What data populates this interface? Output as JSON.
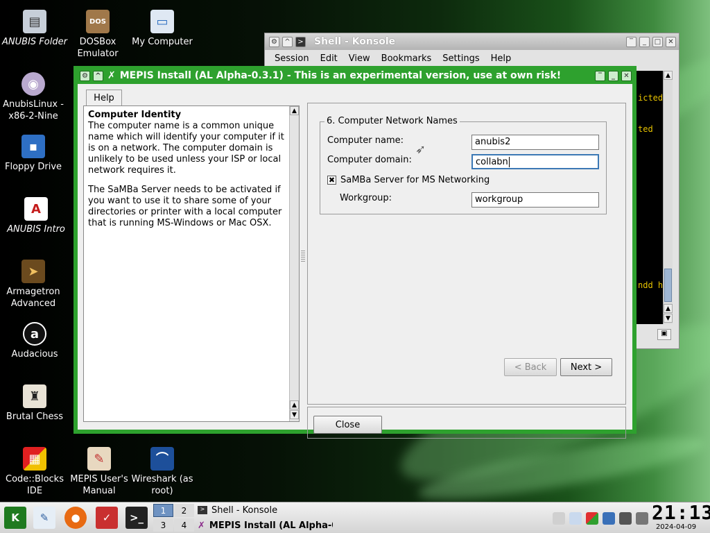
{
  "desktop_icons": [
    {
      "label": "ANUBIS Folder",
      "icon": "folder-icon",
      "italic": true
    },
    {
      "label": "DOSBox Emulator",
      "icon": "dosbox-icon",
      "italic": false
    },
    {
      "label": "My Computer",
      "icon": "computer-icon",
      "italic": false
    },
    {
      "label": "AnubisLinux -x86-2-Nine",
      "icon": "cdrom-icon",
      "italic": false
    },
    {
      "label": "Floppy Drive",
      "icon": "floppy-icon",
      "italic": false
    },
    {
      "label": "ANUBIS Intro",
      "icon": "pdf-icon",
      "italic": true
    },
    {
      "label": "Armagetron Advanced",
      "icon": "armagetron-icon",
      "italic": false
    },
    {
      "label": "Audacious",
      "icon": "audacious-icon",
      "italic": false
    },
    {
      "label": "Brutal Chess",
      "icon": "chess-icon",
      "italic": false
    },
    {
      "label": "Code::Blocks IDE",
      "icon": "codeblocks-icon",
      "italic": false
    },
    {
      "label": "MEPIS User's Manual",
      "icon": "manual-icon",
      "italic": false
    },
    {
      "label": "Wireshark (as root)",
      "icon": "wireshark-icon",
      "italic": false
    }
  ],
  "konsole": {
    "title": "Shell - Konsole",
    "menu": [
      "Session",
      "Edit",
      "View",
      "Bookmarks",
      "Settings",
      "Help"
    ],
    "terminal_lines": [
      "icted",
      "ted",
      "ndd h"
    ]
  },
  "installer": {
    "title": "MEPIS Install (AL Alpha-0.3.1) - This is an experimental version, use at own risk!",
    "help_tab": "Help",
    "help_heading": "Computer Identity",
    "help_para1": "The computer name is a common unique name which will identify your computer if it is on a network. The computer domain is unlikely to be used unless your ISP or local network requires it.",
    "help_para2": "The SaMBa Server needs to be activated if you want to use it to share some of your directories or printer with a local computer that is running MS-Windows or Mac OSX.",
    "group_title": "6. Computer Network Names",
    "computer_name_label": "Computer name:",
    "computer_name_value": "anubis2",
    "computer_domain_label": "Computer domain:",
    "computer_domain_value": "collabn",
    "samba_label": "SaMBa Server for MS Networking",
    "samba_checked": true,
    "samba_mark": "✖",
    "workgroup_label": "Workgroup:",
    "workgroup_value": "workgroup",
    "back_label": "< Back",
    "next_label": "Next >",
    "close_label": "Close"
  },
  "taskbar": {
    "launchers": [
      "kmenu-icon",
      "editor-icon",
      "firefox-icon",
      "manual-icon",
      "terminal-icon"
    ],
    "desktops": [
      "1",
      "2",
      "3",
      "4"
    ],
    "active_desktop": "1",
    "tasks": [
      "Shell - Konsole",
      "MEPIS Install (AL Alpha-0"
    ],
    "time": "21:13",
    "date": "2024-04-09"
  },
  "colors": {
    "installer_frame": "#2ea12e",
    "terminal_text": "#e6c200",
    "focus_border": "#3b78b5"
  }
}
